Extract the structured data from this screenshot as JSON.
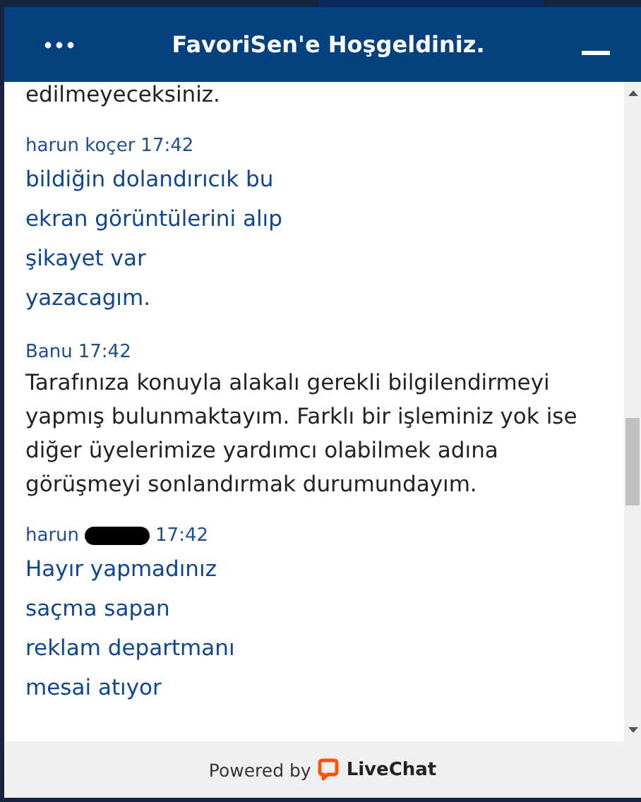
{
  "header": {
    "title": "FavoriSen'e Hoşgeldiniz."
  },
  "messages": [
    {
      "kind": "agent",
      "text": "edilmeyeceksiniz."
    },
    {
      "kind": "visitor",
      "author": "harun koçer",
      "time": "17:42",
      "lines": [
        "bildiğin dolandırıcık bu",
        "ekran görüntülerini alıp",
        "şikayet var",
        "yazacagım."
      ]
    },
    {
      "kind": "agent",
      "author": "Banu",
      "time": "17:42",
      "text": "Tarafınıza konuyla alakalı gerekli bilgilendirmeyi yapmış bulunmaktayım. Farklı bir işleminiz yok ise diğer üyelerimize yardımcı olabilmek adına görüşmeyi sonlandırmak durumundayım."
    },
    {
      "kind": "visitor",
      "author": "harun",
      "redacted": true,
      "time": "17:42",
      "lines": [
        "Hayır yapmadınız",
        "saçma sapan",
        "reklam departmanı",
        "mesai atıyor"
      ]
    }
  ],
  "footer": {
    "prefix": "Powered by",
    "brand": "LiveChat"
  }
}
